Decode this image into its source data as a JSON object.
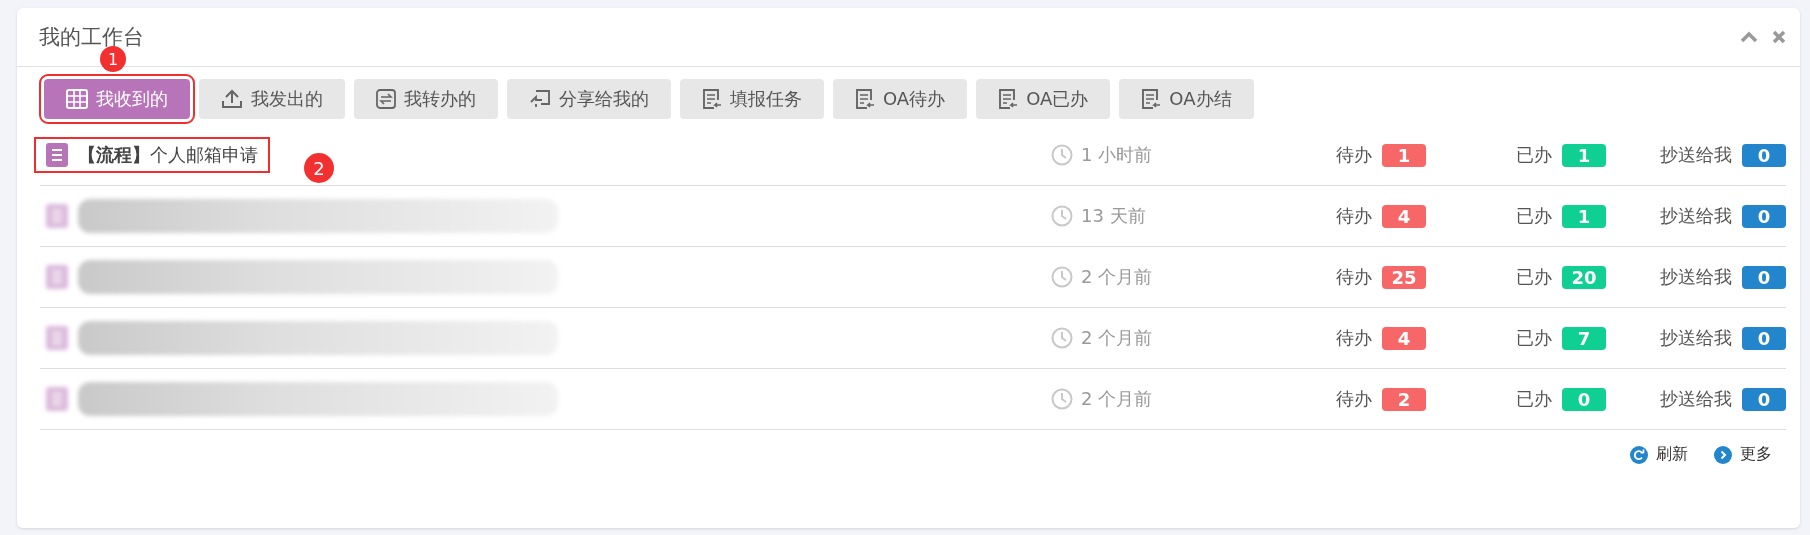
{
  "panel": {
    "title": "我的工作台"
  },
  "tabs": [
    {
      "label": "我收到的",
      "selected": true,
      "marker": "1"
    },
    {
      "label": "我发出的",
      "selected": false
    },
    {
      "label": "我转办的",
      "selected": false
    },
    {
      "label": "分享给我的",
      "selected": false
    },
    {
      "label": "填报任务",
      "selected": false
    },
    {
      "label": "OA待办",
      "selected": false
    },
    {
      "label": "OA已办",
      "selected": false
    },
    {
      "label": "OA办结",
      "selected": false
    }
  ],
  "rows": [
    {
      "tag": "【流程】",
      "title": "个人邮箱申请",
      "redacted": false,
      "marker": "2",
      "time": "1 小时前",
      "counters": [
        {
          "label": "待办",
          "value": "1",
          "color": "#f76767"
        },
        {
          "label": "已办",
          "value": "1",
          "color": "#10cf92"
        },
        {
          "label": "抄送给我",
          "value": "0",
          "color": "#2385cb"
        }
      ]
    },
    {
      "redacted": true,
      "time": "13 天前",
      "counters": [
        {
          "label": "待办",
          "value": "4",
          "color": "#f76767"
        },
        {
          "label": "已办",
          "value": "1",
          "color": "#10cf92"
        },
        {
          "label": "抄送给我",
          "value": "0",
          "color": "#2385cb"
        }
      ]
    },
    {
      "redacted": true,
      "time": "2 个月前",
      "counters": [
        {
          "label": "待办",
          "value": "25",
          "color": "#f76767"
        },
        {
          "label": "已办",
          "value": "20",
          "color": "#10cf92"
        },
        {
          "label": "抄送给我",
          "value": "0",
          "color": "#2385cb"
        }
      ]
    },
    {
      "redacted": true,
      "time": "2 个月前",
      "counters": [
        {
          "label": "待办",
          "value": "4",
          "color": "#f76767"
        },
        {
          "label": "已办",
          "value": "7",
          "color": "#10cf92"
        },
        {
          "label": "抄送给我",
          "value": "0",
          "color": "#2385cb"
        }
      ]
    },
    {
      "redacted": true,
      "time": "2 个月前",
      "counters": [
        {
          "label": "待办",
          "value": "2",
          "color": "#f76767"
        },
        {
          "label": "已办",
          "value": "0",
          "color": "#10cf92"
        },
        {
          "label": "抄送给我",
          "value": "0",
          "color": "#2385cb"
        }
      ]
    }
  ],
  "footer": [
    {
      "kind": "refresh",
      "label": "刷新"
    },
    {
      "kind": "more",
      "label": "更多"
    }
  ]
}
